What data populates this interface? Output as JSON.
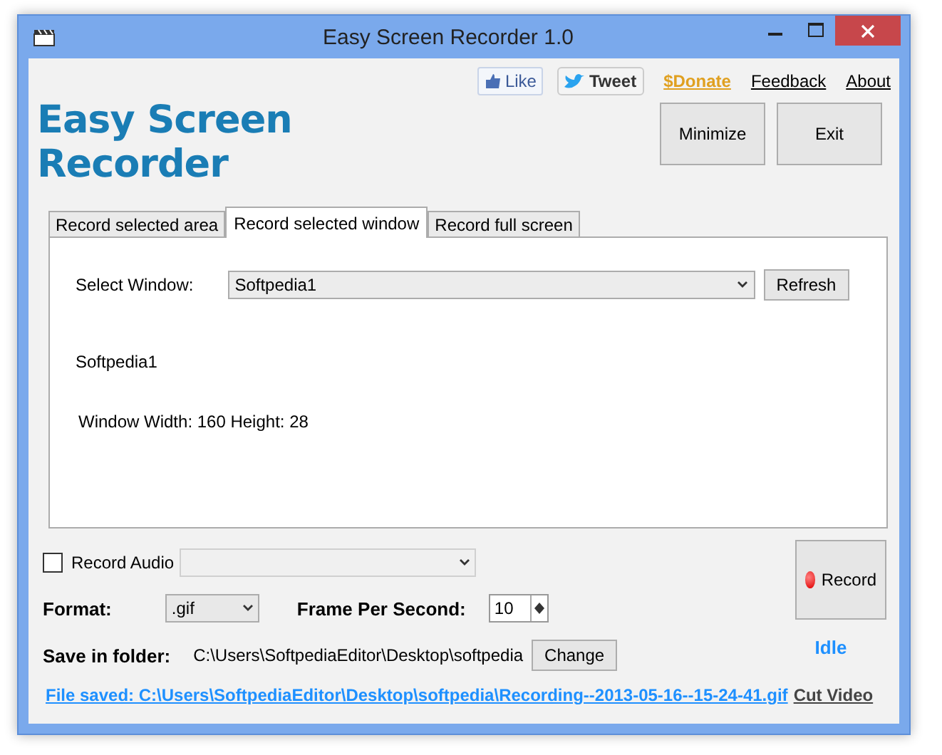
{
  "window": {
    "title": "Easy Screen Recorder 1.0"
  },
  "header": {
    "logo": "Easy Screen Recorder",
    "like": "Like",
    "tweet": "Tweet",
    "links": [
      {
        "label": "$Donate",
        "kind": "donate"
      },
      {
        "label": "Feedback",
        "kind": "plain"
      },
      {
        "label": "About",
        "kind": "plain"
      }
    ],
    "buttons": [
      "Minimize",
      "Exit"
    ]
  },
  "tabs": [
    {
      "label": "Record selected area",
      "selected": false
    },
    {
      "label": "Record selected window",
      "selected": true
    },
    {
      "label": "Record full screen",
      "selected": false
    }
  ],
  "panel": {
    "select_label": "Select Window:",
    "select_value": "Softpedia1",
    "refresh": "Refresh",
    "window_name": "Softpedia1",
    "window_size": "Window Width: 160  Height: 28"
  },
  "record_audio": {
    "label": "Record Audio",
    "checked": false
  },
  "format": {
    "label": "Format:",
    "value": ".gif"
  },
  "fps": {
    "label": "Frame Per Second:",
    "value": "10"
  },
  "save": {
    "label": "Save in folder:",
    "path": "C:\\Users\\SoftpediaEditor\\Desktop\\softpedia",
    "button": "Change"
  },
  "record_button": "Record",
  "status": "Idle",
  "file_saved": "File saved: C:\\Users\\SoftpediaEditor\\Desktop\\softpedia\\Recording--2013-05-16--15-24-41.gif",
  "cut_video": "Cut Video"
}
